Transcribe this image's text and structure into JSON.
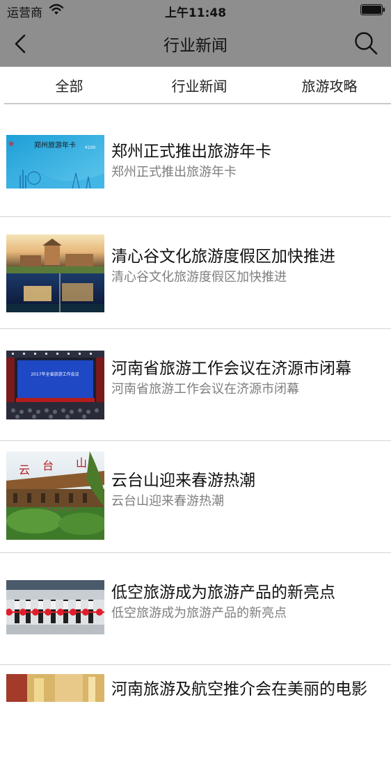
{
  "status": {
    "carrier": "运营商",
    "time": "上午11:48"
  },
  "nav": {
    "title": "行业新闻"
  },
  "tabs": [
    {
      "label": "全部"
    },
    {
      "label": "行业新闻"
    },
    {
      "label": "旅游攻略"
    }
  ],
  "news": [
    {
      "title": "郑州正式推出旅游年卡",
      "subtitle": "郑州正式推出旅游年卡",
      "thumb_text": "郑州旅游年卡"
    },
    {
      "title": "清心谷文化旅游度假区加快推进",
      "subtitle": "清心谷文化旅游度假区加快推进"
    },
    {
      "title": "河南省旅游工作会议在济源市闭幕",
      "subtitle": "河南省旅游工作会议在济源市闭幕",
      "thumb_text": "2017年全省旅游工作会议"
    },
    {
      "title": "云台山迎来春游热潮",
      "subtitle": "云台山迎来春游热潮"
    },
    {
      "title": "低空旅游成为旅游产品的新亮点",
      "subtitle": "低空旅游成为旅游产品的新亮点"
    },
    {
      "title": "河南旅游及航空推介会在美丽的电影",
      "subtitle": ""
    }
  ],
  "colors": {
    "topbar": "#8e8e8e",
    "divider": "#d4d4d4",
    "subtitle": "#7e7e7e"
  }
}
